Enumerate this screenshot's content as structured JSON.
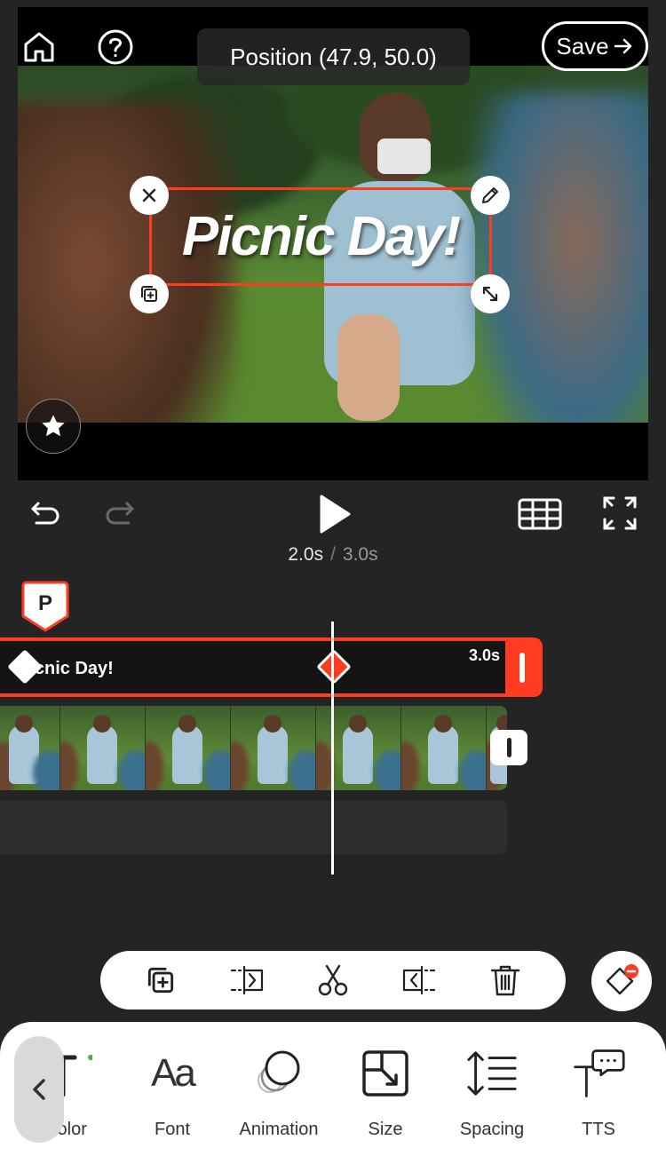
{
  "preview": {
    "overlay_text": "Picnic Day!",
    "tooltip": "Position (47.9, 50.0)",
    "save_label": "Save"
  },
  "playback": {
    "current_time": "2.0s",
    "separator": "/",
    "total_time": "3.0s"
  },
  "timeline": {
    "badge_letter": "P",
    "text_track_label": "Picnic Day!",
    "text_track_duration": "3.0s"
  },
  "tools": [
    {
      "label": "Color",
      "icon": "color-text-icon"
    },
    {
      "label": "Font",
      "icon": "font-icon"
    },
    {
      "label": "Animation",
      "icon": "animation-icon"
    },
    {
      "label": "Size",
      "icon": "size-icon"
    },
    {
      "label": "Spacing",
      "icon": "spacing-icon"
    },
    {
      "label": "TTS",
      "icon": "tts-icon"
    }
  ],
  "colors": {
    "accent": "#ff3b20",
    "background": "#242424",
    "preview_bg": "#000000"
  }
}
